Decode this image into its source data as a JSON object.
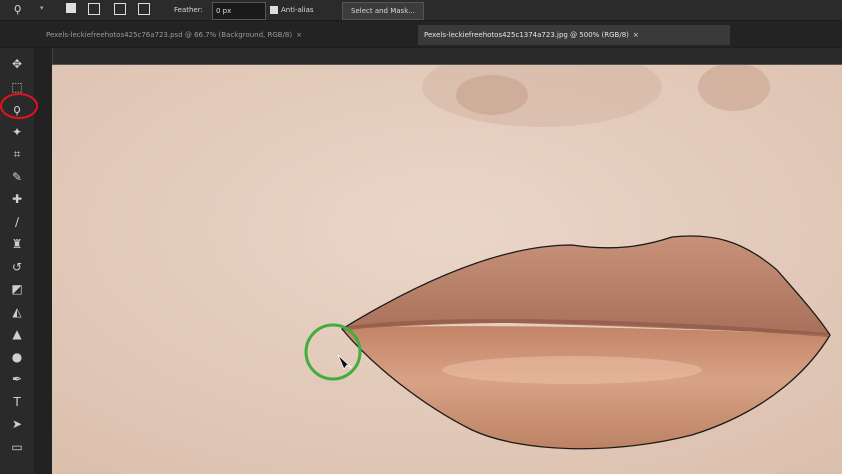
{
  "options_bar": {
    "feather_label": "Feather:",
    "feather_value": "0 px",
    "antialias_label": "Anti-alias",
    "select_mask_label": "Select and Mask..."
  },
  "tabs": [
    {
      "label": "Pexels-leckiefreehotos425c76a723.psd @ 66.7% (Background, RGB/8)",
      "close": "×",
      "active": false
    },
    {
      "label": "Pexels-leckiefreehotos425c1374a723.jpg @ 500% (RGB/8)",
      "close": "×",
      "active": true
    }
  ],
  "tools": [
    {
      "name": "move-tool-icon",
      "glyph": "✥"
    },
    {
      "name": "marquee-tool-icon",
      "glyph": "⬚"
    },
    {
      "name": "lasso-tool-icon",
      "glyph": "ϙ"
    },
    {
      "name": "magic-wand-tool-icon",
      "glyph": "✦"
    },
    {
      "name": "crop-tool-icon",
      "glyph": "⌗"
    },
    {
      "name": "eyedropper-tool-icon",
      "glyph": "✎"
    },
    {
      "name": "healing-brush-tool-icon",
      "glyph": "✚"
    },
    {
      "name": "brush-tool-icon",
      "glyph": "∕"
    },
    {
      "name": "clone-stamp-tool-icon",
      "glyph": "♜"
    },
    {
      "name": "history-brush-tool-icon",
      "glyph": "↺"
    },
    {
      "name": "eraser-tool-icon",
      "glyph": "◩"
    },
    {
      "name": "gradient-tool-icon",
      "glyph": "◭"
    },
    {
      "name": "blur-tool-icon",
      "glyph": "▲"
    },
    {
      "name": "dodge-tool-icon",
      "glyph": "●"
    },
    {
      "name": "pen-tool-icon",
      "glyph": "✒"
    },
    {
      "name": "type-tool-icon",
      "glyph": "T"
    },
    {
      "name": "path-selection-tool-icon",
      "glyph": "➤"
    },
    {
      "name": "shape-tool-icon",
      "glyph": "▭"
    }
  ],
  "colors": {
    "highlight_circle_red": "#e0141e",
    "highlight_circle_green": "#3fae3f",
    "skin": "#e6cfbf",
    "lips": "#c28a6c"
  }
}
